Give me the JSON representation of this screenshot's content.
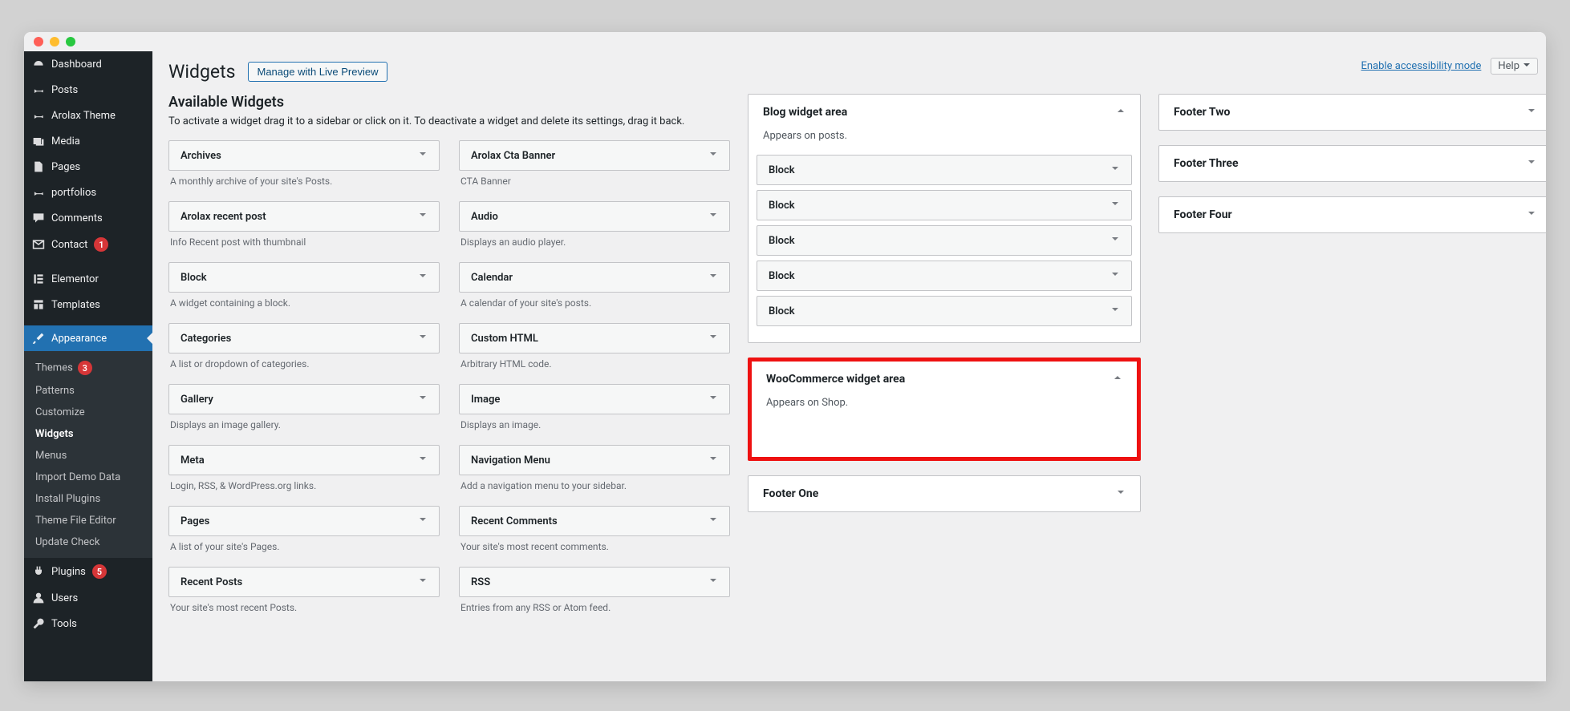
{
  "header": {
    "title": "Widgets",
    "manage_btn": "Manage with Live Preview",
    "accessibility_link": "Enable accessibility mode",
    "help": "Help"
  },
  "available": {
    "title": "Available Widgets",
    "desc": "To activate a widget drag it to a sidebar or click on it. To deactivate a widget and delete its settings, drag it back.",
    "widgets": [
      {
        "name": "Archives",
        "desc": "A monthly archive of your site's Posts."
      },
      {
        "name": "Arolax Cta Banner",
        "desc": "CTA Banner"
      },
      {
        "name": "Arolax recent post",
        "desc": "Info Recent post with thumbnail"
      },
      {
        "name": "Audio",
        "desc": "Displays an audio player."
      },
      {
        "name": "Block",
        "desc": "A widget containing a block."
      },
      {
        "name": "Calendar",
        "desc": "A calendar of your site's posts."
      },
      {
        "name": "Categories",
        "desc": "A list or dropdown of categories."
      },
      {
        "name": "Custom HTML",
        "desc": "Arbitrary HTML code."
      },
      {
        "name": "Gallery",
        "desc": "Displays an image gallery."
      },
      {
        "name": "Image",
        "desc": "Displays an image."
      },
      {
        "name": "Meta",
        "desc": "Login, RSS, & WordPress.org links."
      },
      {
        "name": "Navigation Menu",
        "desc": "Add a navigation menu to your sidebar."
      },
      {
        "name": "Pages",
        "desc": "A list of your site's Pages."
      },
      {
        "name": "Recent Comments",
        "desc": "Your site's most recent comments."
      },
      {
        "name": "Recent Posts",
        "desc": "Your site's most recent Posts."
      },
      {
        "name": "RSS",
        "desc": "Entries from any RSS or Atom feed."
      }
    ]
  },
  "areas_mid": [
    {
      "title": "Blog widget area",
      "desc": "Appears on posts.",
      "expanded": true,
      "blocks": [
        "Block",
        "Block",
        "Block",
        "Block",
        "Block"
      ]
    },
    {
      "title": "WooCommerce widget area",
      "desc": "Appears on Shop.",
      "expanded": true,
      "highlight": true,
      "blocks": []
    },
    {
      "title": "Footer One",
      "expanded": false
    }
  ],
  "areas_right": [
    {
      "title": "Footer Two",
      "expanded": false
    },
    {
      "title": "Footer Three",
      "expanded": false
    },
    {
      "title": "Footer Four",
      "expanded": false
    }
  ],
  "sidebar": {
    "items": [
      {
        "icon": "dashboard",
        "label": "Dashboard"
      },
      {
        "icon": "pin",
        "label": "Posts"
      },
      {
        "icon": "pin",
        "label": "Arolax Theme"
      },
      {
        "icon": "media",
        "label": "Media"
      },
      {
        "icon": "page",
        "label": "Pages"
      },
      {
        "icon": "pin",
        "label": "portfolios"
      },
      {
        "icon": "comment",
        "label": "Comments"
      },
      {
        "icon": "mail",
        "label": "Contact",
        "badge": "1"
      },
      {
        "sep": true
      },
      {
        "icon": "elementor",
        "label": "Elementor"
      },
      {
        "icon": "templates",
        "label": "Templates"
      },
      {
        "sep": true
      },
      {
        "icon": "brush",
        "label": "Appearance",
        "active": true
      },
      {
        "icon": "plugin",
        "label": "Plugins",
        "badge": "5"
      },
      {
        "icon": "user",
        "label": "Users"
      },
      {
        "icon": "tools",
        "label": "Tools"
      }
    ],
    "submenu": [
      {
        "label": "Themes",
        "badge": "3"
      },
      {
        "label": "Patterns"
      },
      {
        "label": "Customize"
      },
      {
        "label": "Widgets",
        "current": true
      },
      {
        "label": "Menus"
      },
      {
        "label": "Import Demo Data"
      },
      {
        "label": "Install Plugins"
      },
      {
        "label": "Theme File Editor"
      },
      {
        "label": "Update Check"
      }
    ]
  }
}
